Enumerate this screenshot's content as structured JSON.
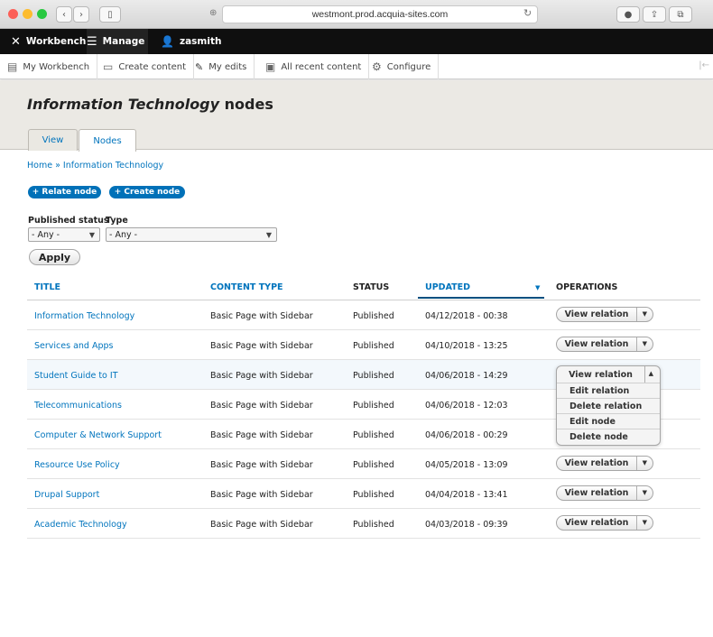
{
  "browser": {
    "url": "westmont.prod.acquia-sites.com",
    "traffic_colors": [
      "#fc5f57",
      "#fdbc2e",
      "#28c840"
    ]
  },
  "toolbar": {
    "workbench": "Workbench",
    "manage": "Manage",
    "user": "zasmith"
  },
  "tray": [
    {
      "label": "My Workbench",
      "icon": "table-icon"
    },
    {
      "label": "Create content",
      "icon": "document-add-icon"
    },
    {
      "label": "My edits",
      "icon": "pencil-icon"
    },
    {
      "label": "All recent content",
      "icon": "documents-icon"
    },
    {
      "label": "Configure",
      "icon": "gear-icon"
    }
  ],
  "page": {
    "title_em": "Information Technology",
    "title_rest": "nodes",
    "tabs": [
      "View",
      "Nodes"
    ],
    "active_tab": "Nodes",
    "breadcrumb": "Home » Information Technology",
    "relate_button": "+ Relate node",
    "create_button": "+ Create node"
  },
  "filters": {
    "status_label": "Published status",
    "status_value": "- Any -",
    "type_label": "Type",
    "type_value": "- Any -",
    "apply": "Apply"
  },
  "table": {
    "headers": [
      "TITLE",
      "CONTENT TYPE",
      "STATUS",
      "UPDATED",
      "OPERATIONS"
    ],
    "sort_column": "UPDATED",
    "rows": [
      {
        "title": "Information Technology",
        "type": "Basic Page with Sidebar",
        "status": "Published",
        "updated": "04/12/2018 - 00:38",
        "op": "View relation"
      },
      {
        "title": "Services and Apps",
        "type": "Basic Page with Sidebar",
        "status": "Published",
        "updated": "04/10/2018 - 13:25",
        "op": "View relation"
      },
      {
        "title": "Student Guide to IT",
        "type": "Basic Page with Sidebar",
        "status": "Published",
        "updated": "04/06/2018 - 14:29",
        "op": "View relation"
      },
      {
        "title": "Telecommunications",
        "type": "Basic Page with Sidebar",
        "status": "Published",
        "updated": "04/06/2018 - 12:03",
        "op": ""
      },
      {
        "title": "Computer & Network Support",
        "type": "Basic Page with Sidebar",
        "status": "Published",
        "updated": "04/06/2018 - 00:29",
        "op": ""
      },
      {
        "title": "Resource Use Policy",
        "type": "Basic Page with Sidebar",
        "status": "Published",
        "updated": "04/05/2018 - 13:09",
        "op": "View relation"
      },
      {
        "title": "Drupal Support",
        "type": "Basic Page with Sidebar",
        "status": "Published",
        "updated": "04/04/2018 - 13:41",
        "op": "View relation"
      },
      {
        "title": "Academic Technology",
        "type": "Basic Page with Sidebar",
        "status": "Published",
        "updated": "04/03/2018 - 09:39",
        "op": "View relation"
      }
    ],
    "open_dropdown": [
      "Edit relation",
      "Delete relation",
      "Edit node",
      "Delete node"
    ]
  }
}
